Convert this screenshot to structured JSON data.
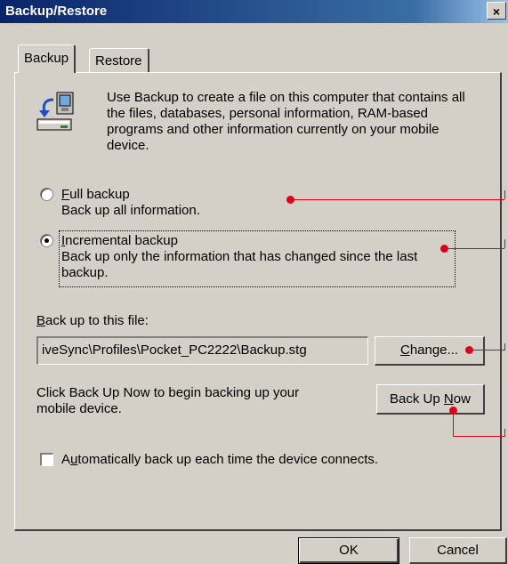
{
  "window": {
    "title": "Backup/Restore",
    "close_symbol": "×"
  },
  "tabs": [
    {
      "label": "Backup",
      "selected": true
    },
    {
      "label": "Restore",
      "selected": false
    }
  ],
  "intro": {
    "icon": "device-backup-icon",
    "text": "Use Backup to create a file on this computer that contains all the files, databases, personal information, RAM-based programs and other information currently on your mobile device."
  },
  "options": {
    "full": {
      "mnemonic": "F",
      "title_rest": "ull backup",
      "desc": "Back up all information.",
      "selected": false
    },
    "incremental": {
      "mnemonic": "I",
      "title_rest": "ncremental backup",
      "desc": "Back up only the information that has changed since the last backup.",
      "selected": true
    }
  },
  "file": {
    "label_mnemonic": "B",
    "label_rest": "ack up to this file:",
    "value": "iveSync\\Profiles\\Pocket_PC2222\\Backup.stg",
    "change_pre": "",
    "change_mnemonic": "C",
    "change_rest": "hange..."
  },
  "backup_now": {
    "instruction": "Click Back Up Now to begin backing up your mobile device.",
    "button_pre": "Back Up ",
    "button_mnemonic": "N",
    "button_rest": "ow"
  },
  "auto_backup": {
    "pre": "A",
    "mnemonic": "u",
    "rest": "tomatically back up each time the device connects.",
    "checked": false
  },
  "footer": {
    "ok_label": "OK",
    "cancel_label": "Cancel"
  },
  "callout_color": "#e0001a"
}
